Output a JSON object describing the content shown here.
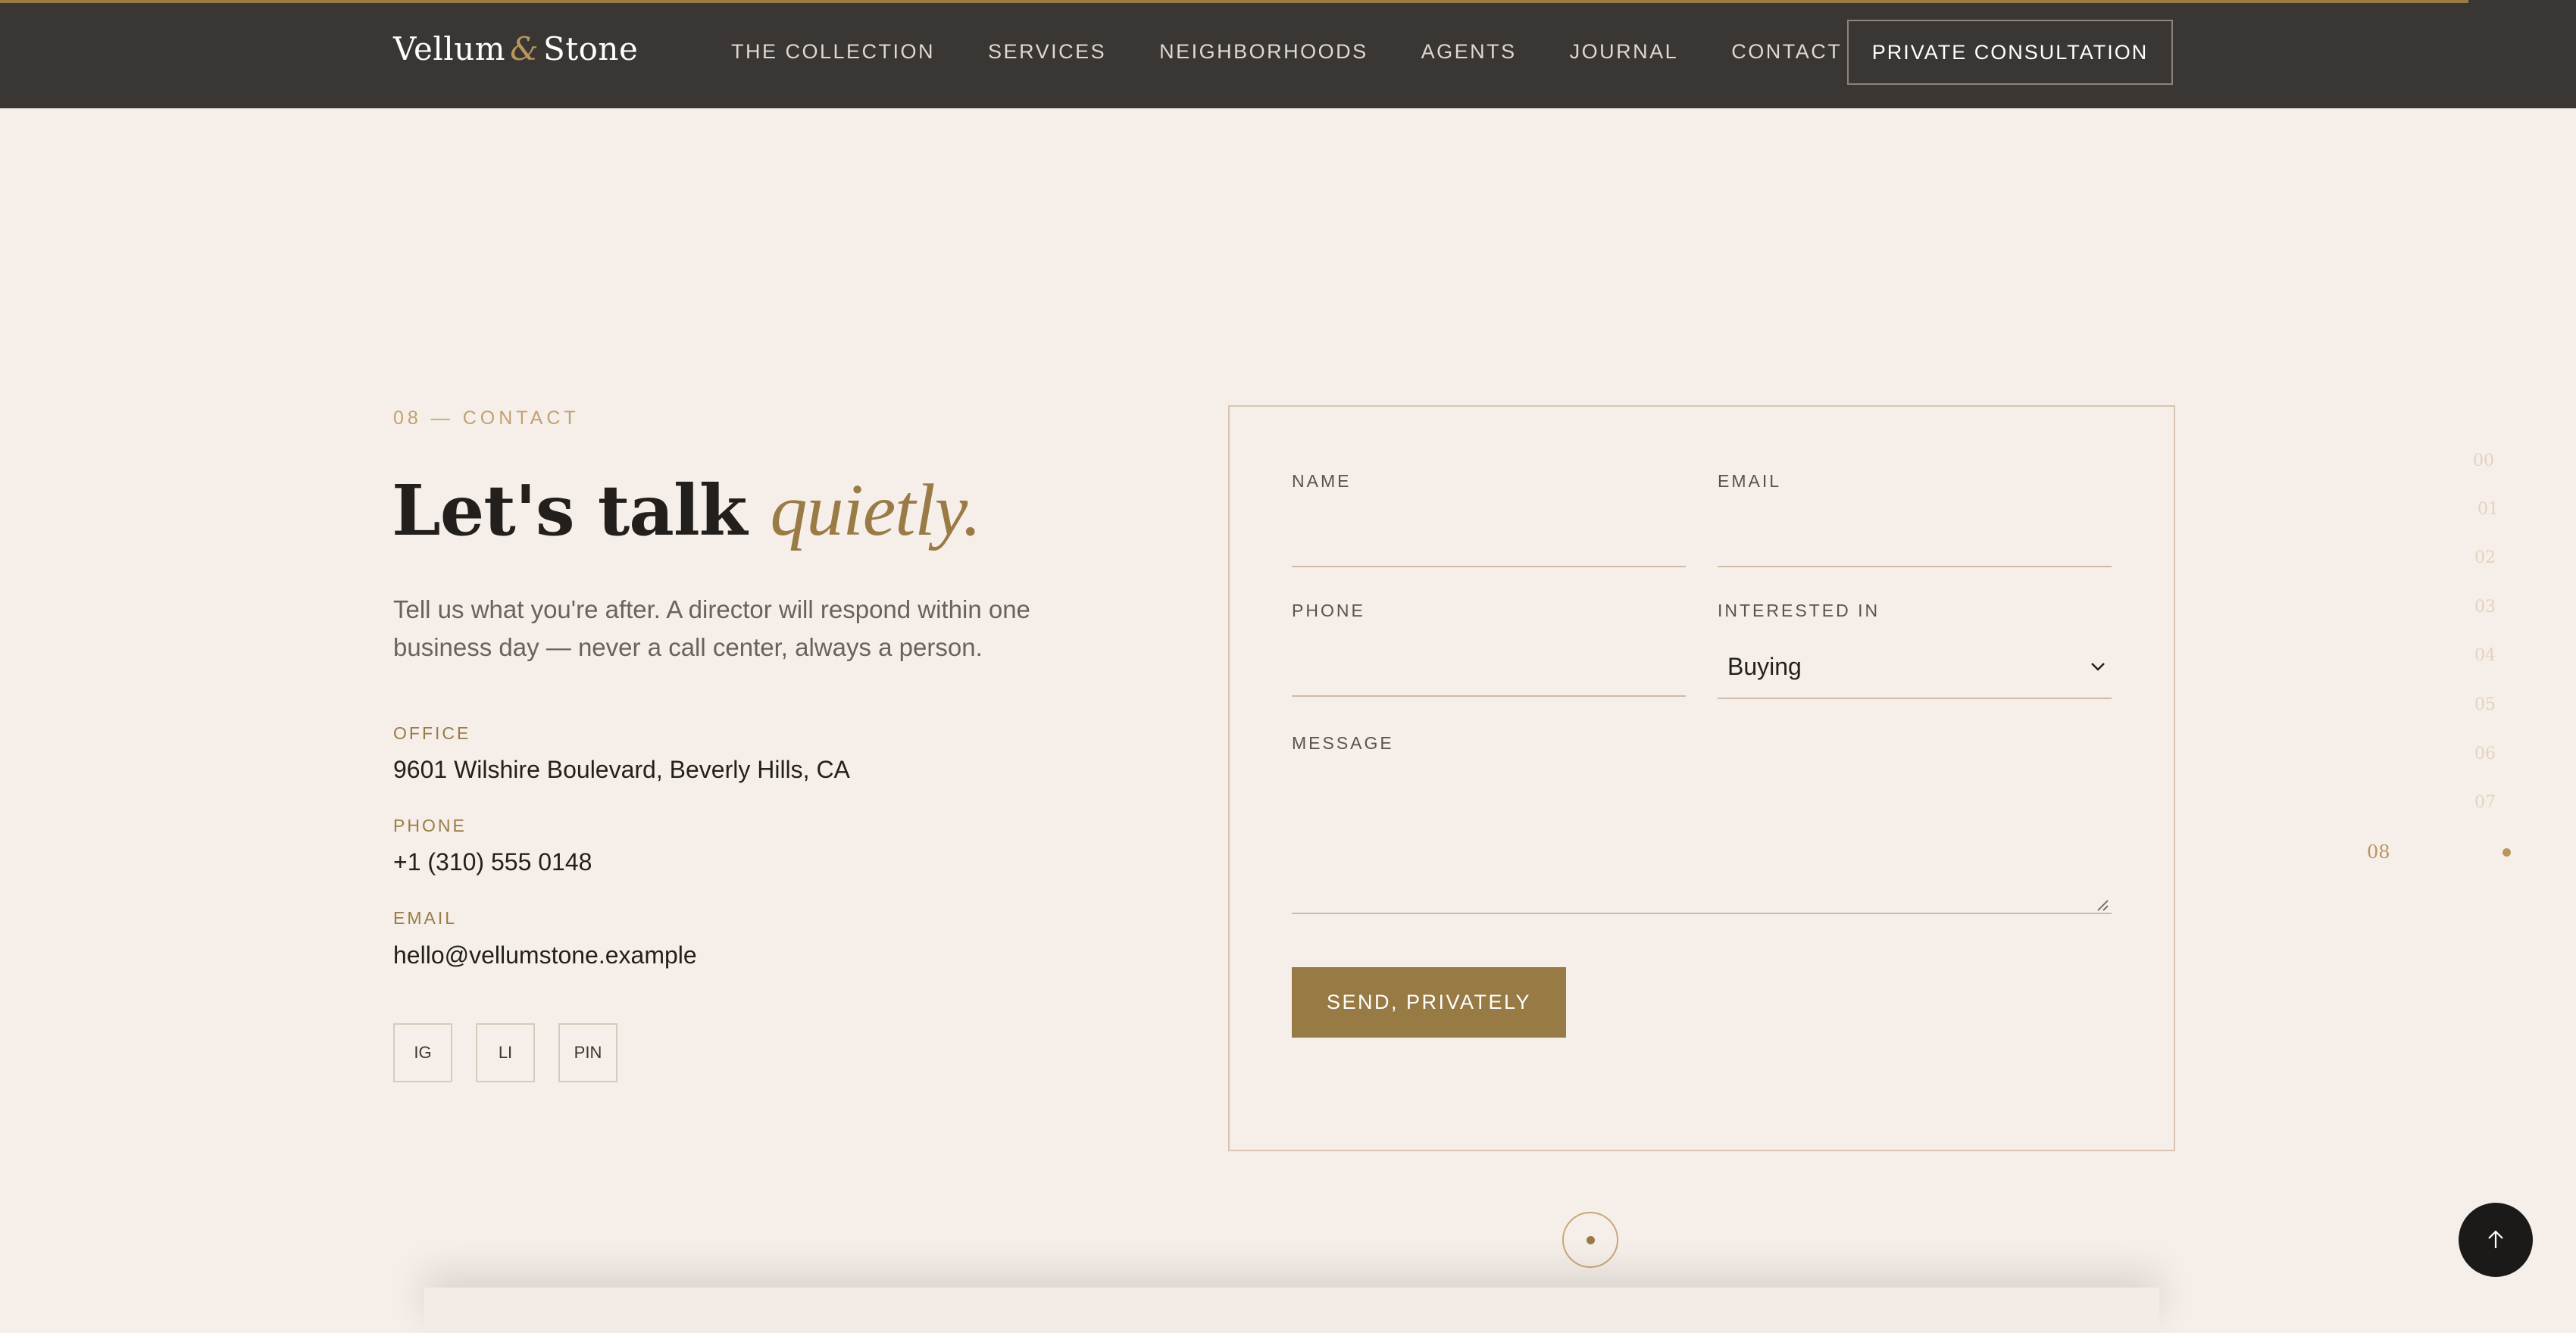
{
  "header": {
    "brand_left": "Vellum",
    "brand_amp": "&",
    "brand_right": "Stone",
    "nav": [
      "THE COLLECTION",
      "SERVICES",
      "NEIGHBORHOODS",
      "AGENTS",
      "JOURNAL",
      "CONTACT"
    ],
    "cta": "PRIVATE CONSULTATION"
  },
  "contact": {
    "eyebrow": "08 — CONTACT",
    "headline_plain": "Let's talk",
    "headline_accent": "quietly.",
    "lede": "Tell us what you're after. A director will respond within one business day — never a call center, always a person.",
    "office_label": "OFFICE",
    "office_value": "9601 Wilshire Boulevard, Beverly Hills, CA",
    "phone_label": "PHONE",
    "phone_value": "+1 (310) 555 0148",
    "email_label": "EMAIL",
    "email_value": "hello@vellumstone.example",
    "social": [
      "IG",
      "LI",
      "PIN"
    ]
  },
  "form": {
    "name_label": "NAME",
    "name_value": "",
    "email_label": "EMAIL",
    "email_value": "",
    "phone_label": "PHONE",
    "phone_value": "",
    "interest_label": "INTERESTED IN",
    "interest_selected": "Buying",
    "message_label": "MESSAGE",
    "message_value": "",
    "submit": "SEND, PRIVATELY"
  },
  "section_rail": {
    "items": [
      "00",
      "01",
      "02",
      "03",
      "04",
      "05",
      "06",
      "07"
    ],
    "active": "08"
  },
  "colors": {
    "background": "#f6efe9",
    "header": "#3a3634",
    "accent": "#9a7b45",
    "button": "#987a45"
  },
  "icons": [
    "chevron-down-icon",
    "resize-handle-icon",
    "scroll-indicator-icon",
    "arrow-up-icon"
  ]
}
